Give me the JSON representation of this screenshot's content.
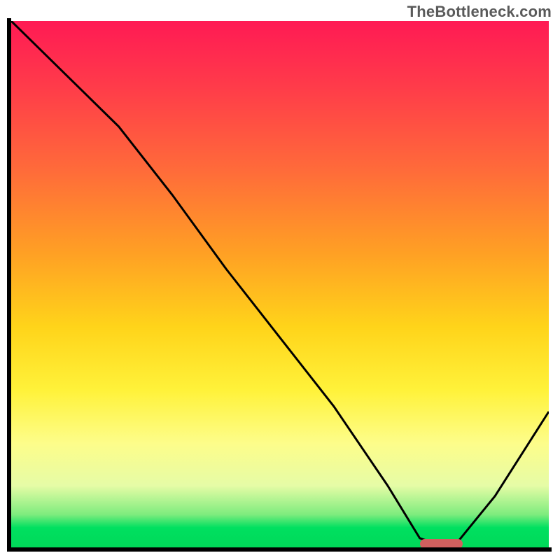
{
  "watermark": "TheBottleneck.com",
  "colors": {
    "marker": "#d1605e",
    "curve": "#000000"
  },
  "chart_data": {
    "type": "line",
    "title": "",
    "xlabel": "",
    "ylabel": "",
    "xlim": [
      0,
      100
    ],
    "ylim": [
      0,
      100
    ],
    "x": [
      0,
      10,
      20,
      30,
      40,
      50,
      60,
      70,
      76,
      82,
      90,
      100
    ],
    "values": [
      100,
      90,
      80,
      67,
      53,
      40,
      27,
      12,
      2,
      0,
      10,
      26
    ],
    "marker_range_x": [
      76,
      84
    ],
    "gradient_stops": [
      {
        "pos": 0,
        "color": "#ff1a54"
      },
      {
        "pos": 0.5,
        "color": "#ffd41a"
      },
      {
        "pos": 0.8,
        "color": "#fdfd8a"
      },
      {
        "pos": 1.0,
        "color": "#00d858"
      }
    ]
  }
}
